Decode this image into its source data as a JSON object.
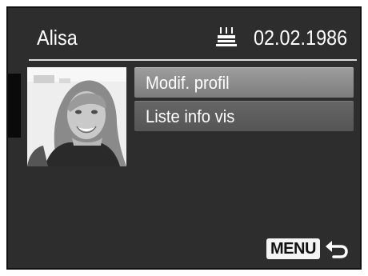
{
  "header": {
    "person_name": "Alisa",
    "birthday_icon": "birthday-cake-icon",
    "birth_date": "02.02.1986"
  },
  "menu": {
    "items": [
      {
        "label": "Modif. profil",
        "selected": true
      },
      {
        "label": "Liste info vis",
        "selected": false
      }
    ]
  },
  "footer": {
    "menu_button_label": "MENU",
    "back_icon": "return-arrow-icon"
  },
  "colors": {
    "background": "#2d2d2d",
    "selected_item": "#8c8c8c",
    "normal_item": "#5e5e5e",
    "text": "#ffffff"
  }
}
